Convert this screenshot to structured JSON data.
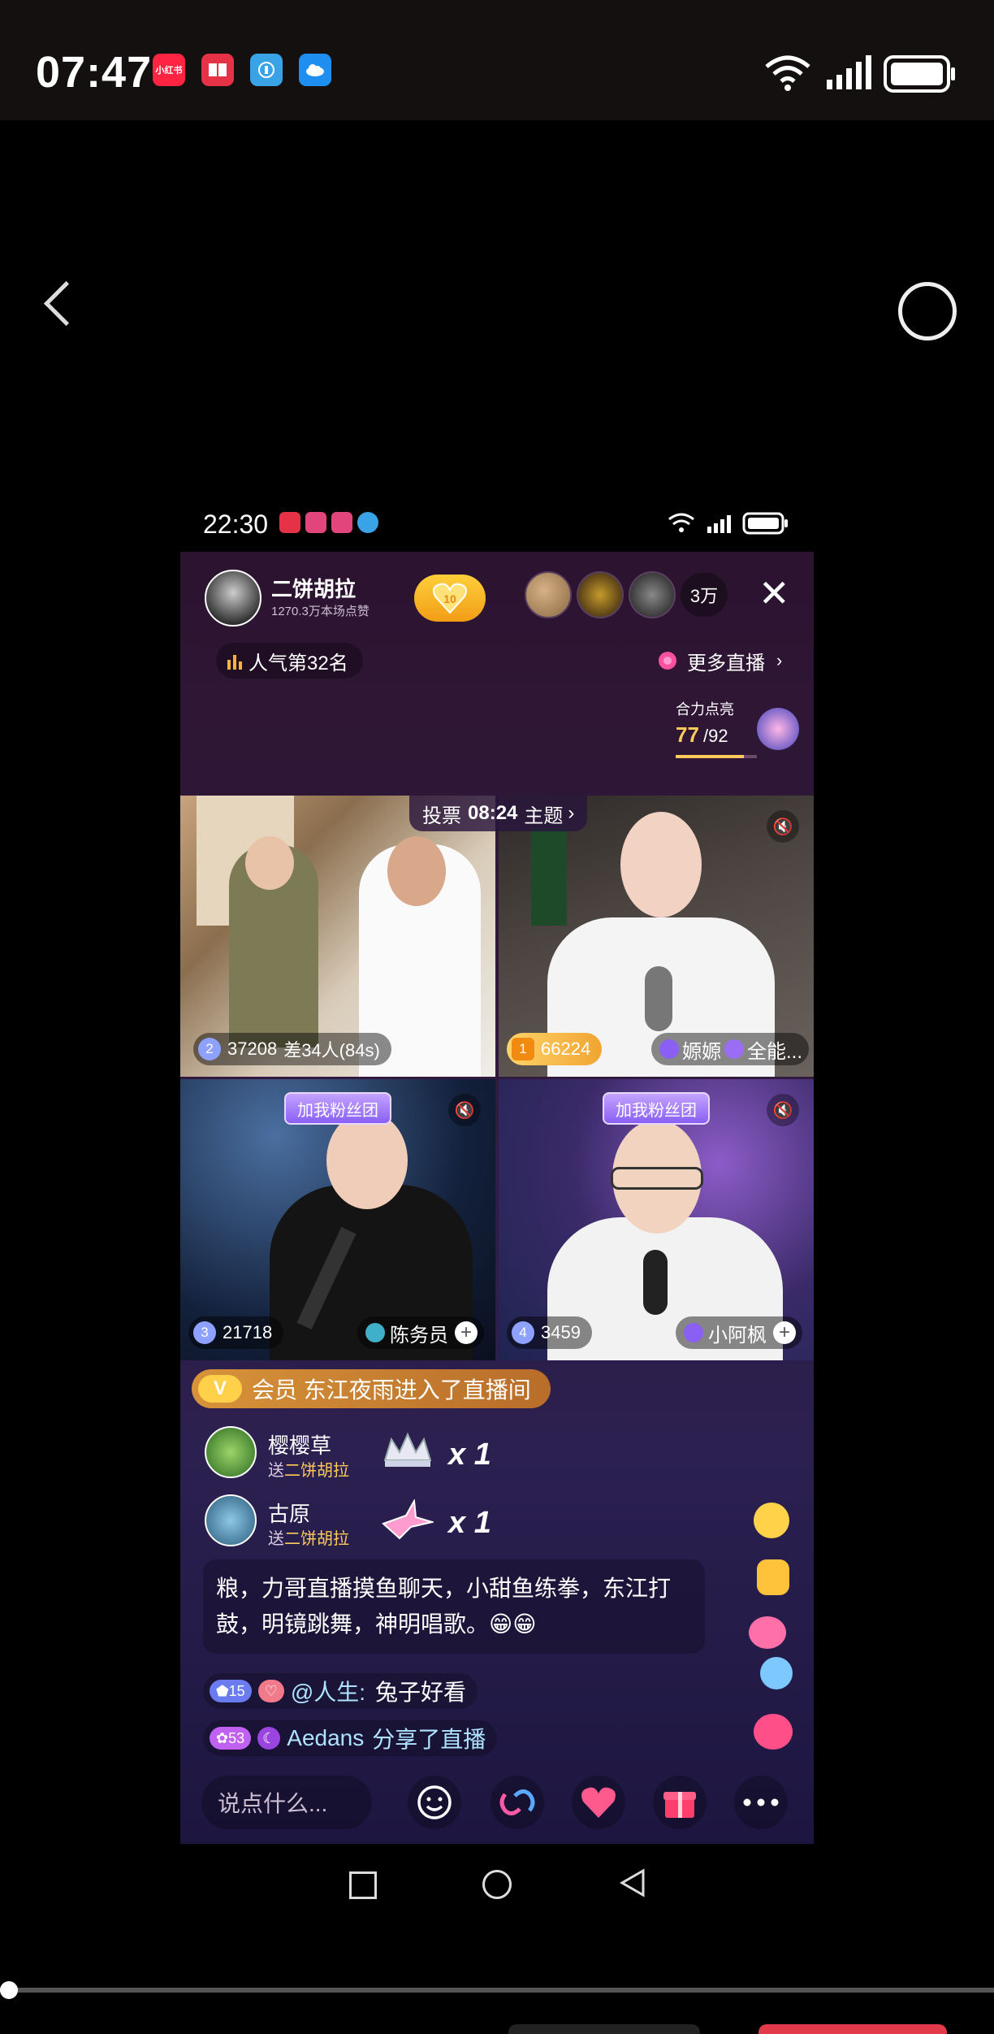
{
  "outer_status": {
    "time": "07:47",
    "apps": [
      {
        "name": "xiaohongshu-app-icon",
        "label": "小红书",
        "color": "#ff2442"
      },
      {
        "name": "red-book-app-icon",
        "label": "",
        "color": "#e63246"
      },
      {
        "name": "blue-app-icon",
        "label": "",
        "color": "#3aa2e6"
      },
      {
        "name": "cloud-app-icon",
        "label": "",
        "color": "#1f8ef1"
      }
    ]
  },
  "inner_status": {
    "time": "22:30"
  },
  "host": {
    "name": "二饼胡拉",
    "likes": "1270.3万本场点赞",
    "follow_level": "10"
  },
  "viewers": {
    "count": "3万"
  },
  "rank": {
    "label": "人气第32名"
  },
  "more_live": {
    "label": "更多直播"
  },
  "heli": {
    "label": "合力点亮",
    "current": "77",
    "total": "/92",
    "progress": 0.837
  },
  "vote": {
    "label": "投票",
    "timer": "08:24",
    "topic": "主题"
  },
  "cells": [
    {
      "rank": "2",
      "score": "37208",
      "note": "差34人(84s)"
    },
    {
      "rank": "1",
      "score": "66224",
      "name": "嫄嫄",
      "tag": "全能..."
    },
    {
      "rank": "3",
      "score": "21718",
      "name": "陈务员",
      "fan": "加我粉丝团"
    },
    {
      "rank": "4",
      "score": "3459",
      "name": "小阿枫",
      "fan": "加我粉丝团"
    }
  ],
  "entry": {
    "badge": "V",
    "text": "会员 东江夜雨进入了直播间"
  },
  "gifts": [
    {
      "user": "樱樱草",
      "to_prefix": "送",
      "to": "二饼胡拉",
      "count": "1"
    },
    {
      "user": "古原",
      "to_prefix": "送",
      "to": "二饼胡拉",
      "count": "1"
    }
  ],
  "chat": {
    "block": "粮，力哥直播摸鱼聊天，小甜鱼练拳，东江打鼓，明镜跳舞，神明唱歌。😁😁",
    "line1": {
      "level": "15",
      "user": "@人生:",
      "text": "兔子好看"
    },
    "line2": {
      "level": "53",
      "user": "Aedans",
      "text": "分享了直播"
    }
  },
  "input": {
    "placeholder": "说点什么..."
  },
  "colors": {
    "accent": "#ff4fa0",
    "gold": "#ffca5c",
    "bg_top": "#2c1430",
    "bg_bottom": "#1d1640"
  }
}
